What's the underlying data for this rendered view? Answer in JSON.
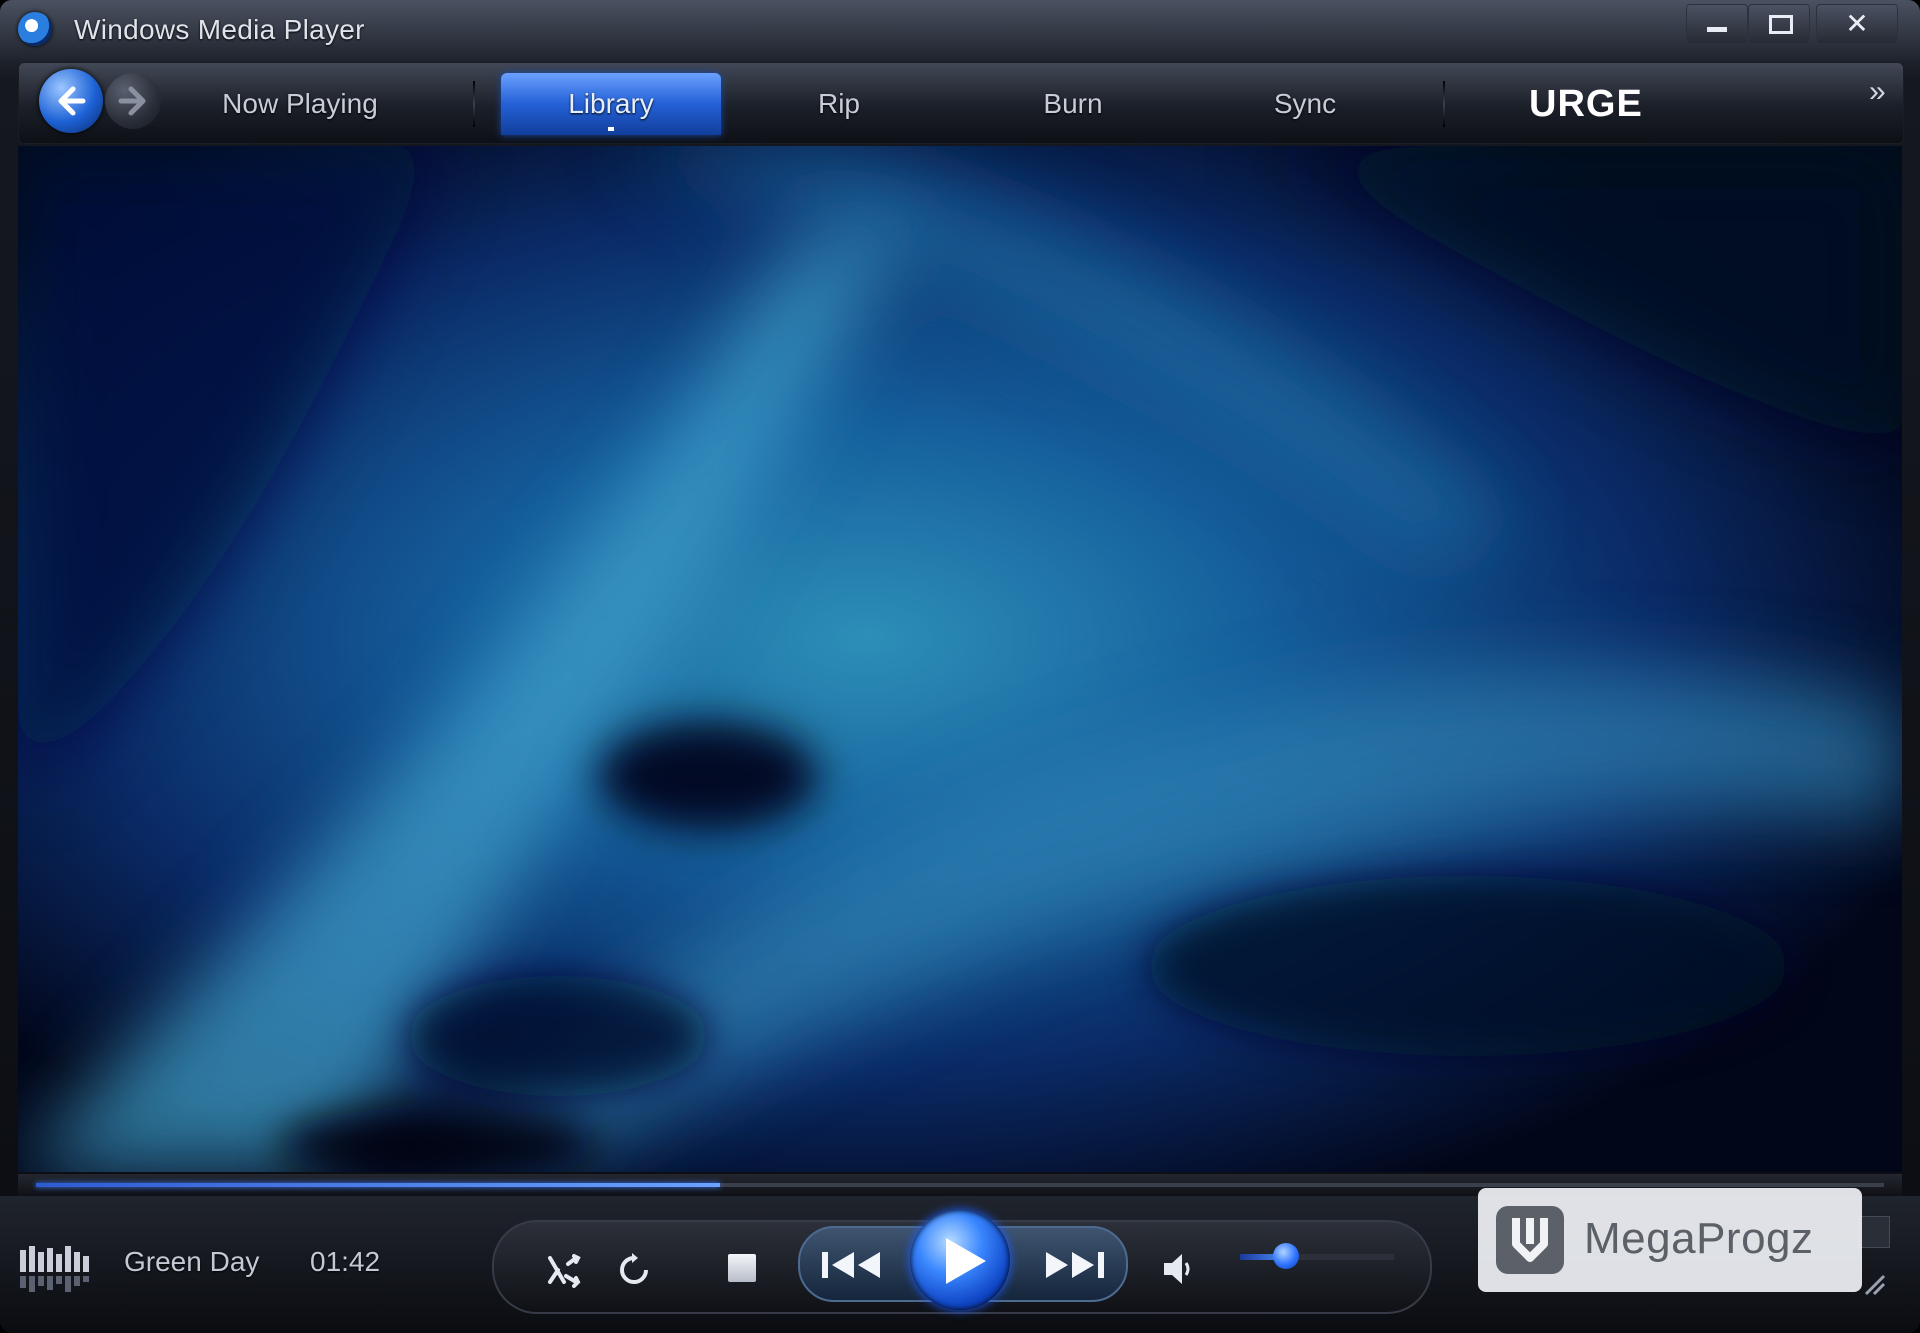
{
  "window": {
    "title": "Windows Media Player",
    "controls": [
      "minimize",
      "maximize",
      "close"
    ]
  },
  "navigation": {
    "tabs": [
      {
        "label": "Now Playing",
        "active": false
      },
      {
        "label": "Library",
        "active": true
      },
      {
        "label": "Rip",
        "active": false
      },
      {
        "label": "Burn",
        "active": false
      },
      {
        "label": "Sync",
        "active": false
      }
    ],
    "store_label": "URGE",
    "overflow_label": "»"
  },
  "now_playing": {
    "artist": "Green Day",
    "elapsed": "01:42",
    "seek_progress": 0.37,
    "volume": 0.3
  },
  "icons": {
    "back": "back-arrow-icon",
    "forward": "forward-arrow-icon",
    "shuffle": "shuffle-icon",
    "repeat": "repeat-icon",
    "stop": "stop-icon",
    "previous": "previous-track-icon",
    "play": "play-icon",
    "next": "next-track-icon",
    "mute": "speaker-icon"
  },
  "colors": {
    "accent": "#2461d6",
    "visualization": "#0b3a7a"
  },
  "watermark": {
    "text": "MegaProgz"
  }
}
